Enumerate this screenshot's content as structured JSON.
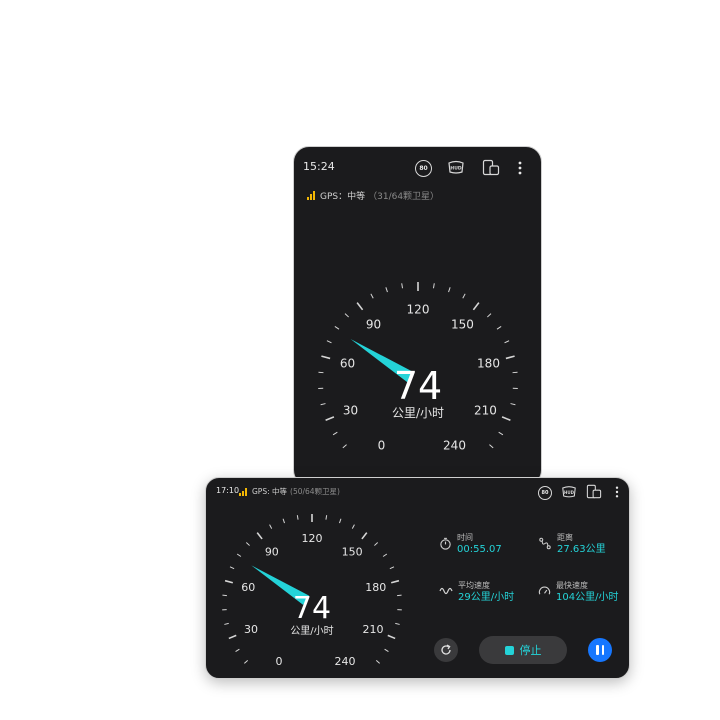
{
  "portrait": {
    "status": {
      "time": "15:24",
      "speed_limit_badge": "80",
      "hud_label": "HUD"
    },
    "gps": {
      "label": "GPS：中等",
      "satellites": "（31/64颗卫星）"
    },
    "speedometer": {
      "tick_labels": [
        "0",
        "30",
        "60",
        "90",
        "120",
        "150",
        "180",
        "210",
        "240"
      ],
      "max": 240,
      "speed": "74",
      "speed_value": 74,
      "unit": "公里/小时"
    }
  },
  "landscape": {
    "status": {
      "time": "17:10",
      "speed_limit_badge": "80",
      "hud_label": "HUD"
    },
    "gps": {
      "label": "GPS: 中等",
      "satellites": "(50/64颗卫星)"
    },
    "speedometer": {
      "tick_labels": [
        "0",
        "30",
        "60",
        "90",
        "120",
        "150",
        "180",
        "210",
        "240"
      ],
      "max": 240,
      "speed": "74",
      "speed_value": 74,
      "unit": "公里/小时"
    },
    "stats": {
      "time": {
        "label": "时间",
        "value": "00:55.07"
      },
      "distance": {
        "label": "距离",
        "value": "27.63公里"
      },
      "avg_speed": {
        "label": "平均速度",
        "value": "29公里/小时"
      },
      "max_speed": {
        "label": "最快速度",
        "value": "104公里/小时"
      }
    },
    "controls": {
      "stop_label": "停止"
    }
  },
  "colors": {
    "accent": "#24d3d8",
    "primary_button": "#1677ff",
    "gps_bars": "#f2b705",
    "background": "#1b1b1d"
  },
  "icons": [
    "speed-limit-icon",
    "hud-icon",
    "screen-rotate-icon",
    "more-icon",
    "stopwatch-icon",
    "route-icon",
    "wave-icon",
    "gauge-icon",
    "refresh-icon",
    "pause-icon"
  ]
}
